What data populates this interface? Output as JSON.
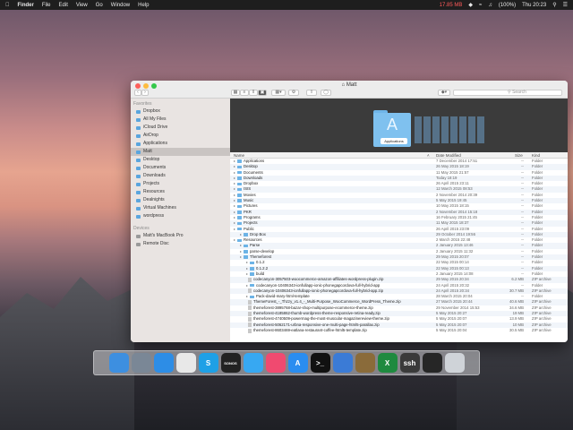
{
  "menubar": {
    "app": "Finder",
    "items": [
      "File",
      "Edit",
      "View",
      "Go",
      "Window",
      "Help"
    ],
    "memory": "17.85 MB",
    "battery": "(100%)",
    "clock": "Thu 20:23"
  },
  "window": {
    "title": "Matt",
    "search_placeholder": "Search"
  },
  "sidebar": {
    "favorites_header": "Favorites",
    "favorites": [
      "Dropbox",
      "All My Files",
      "iCloud Drive",
      "AirDrop",
      "Applications",
      "Matt",
      "Desktop",
      "Documents",
      "Downloads",
      "Projects",
      "Resources",
      "Dealnights",
      "Virtual Machines",
      "wordpress"
    ],
    "selected_index": 5,
    "devices_header": "Devices",
    "devices": [
      "Matt's MacBook Pro",
      "Remote Disc"
    ]
  },
  "coverflow": {
    "caption": "Applications"
  },
  "columns": {
    "name": "Name",
    "date": "Date Modified",
    "size": "Size",
    "kind": "Kind"
  },
  "rows": [
    {
      "name": "Applications",
      "date": "7 December 2014 17:51",
      "size": "--",
      "kind": "Folder",
      "indent": 0,
      "type": "folder"
    },
    {
      "name": "Desktop",
      "date": "26 May 2015 18:19",
      "size": "--",
      "kind": "Folder",
      "indent": 0,
      "type": "folder"
    },
    {
      "name": "Documents",
      "date": "11 May 2015 21:57",
      "size": "--",
      "kind": "Folder",
      "indent": 0,
      "type": "folder"
    },
    {
      "name": "Downloads",
      "date": "Today 18:19",
      "size": "--",
      "kind": "Folder",
      "indent": 0,
      "type": "folder"
    },
    {
      "name": "Dropbox",
      "date": "26 April 2015 23:11",
      "size": "--",
      "kind": "Folder",
      "indent": 0,
      "type": "folder"
    },
    {
      "name": "ISIS",
      "date": "12 March 2015 08:53",
      "size": "--",
      "kind": "Folder",
      "indent": 0,
      "type": "folder"
    },
    {
      "name": "Movies",
      "date": "2 November 2014 20:39",
      "size": "--",
      "kind": "Folder",
      "indent": 0,
      "type": "folder"
    },
    {
      "name": "Music",
      "date": "5 May 2015 19:45",
      "size": "--",
      "kind": "Folder",
      "indent": 0,
      "type": "folder"
    },
    {
      "name": "Pictures",
      "date": "10 May 2015 18:15",
      "size": "--",
      "kind": "Folder",
      "indent": 0,
      "type": "folder"
    },
    {
      "name": "PKR",
      "date": "2 November 2014 15:18",
      "size": "--",
      "kind": "Folder",
      "indent": 0,
      "type": "folder"
    },
    {
      "name": "Programs",
      "date": "16 February 2015 21:45",
      "size": "--",
      "kind": "Folder",
      "indent": 0,
      "type": "folder"
    },
    {
      "name": "Projects",
      "date": "11 May 2015 18:37",
      "size": "--",
      "kind": "Folder",
      "indent": 0,
      "type": "folder"
    },
    {
      "name": "Public",
      "date": "26 April 2015 23:09",
      "size": "--",
      "kind": "Folder",
      "indent": 0,
      "type": "folder"
    },
    {
      "name": "Drop Box",
      "date": "29 October 2014 19:56",
      "size": "--",
      "kind": "Folder",
      "indent": 1,
      "type": "folder"
    },
    {
      "name": "Resources",
      "date": "2 March 2015 22:48",
      "size": "--",
      "kind": "Folder",
      "indent": 0,
      "type": "folder"
    },
    {
      "name": "Parse",
      "date": "2 January 2015 13:46",
      "size": "--",
      "kind": "Folder",
      "indent": 1,
      "type": "folder"
    },
    {
      "name": "parse-develop",
      "date": "2 January 2015 11:32",
      "size": "--",
      "kind": "Folder",
      "indent": 1,
      "type": "folder"
    },
    {
      "name": "Themeforest",
      "date": "29 May 2015 20:07",
      "size": "--",
      "kind": "Folder",
      "indent": 1,
      "type": "folder"
    },
    {
      "name": "0.1.2",
      "date": "22 May 2015 00:14",
      "size": "--",
      "kind": "Folder",
      "indent": 2,
      "type": "folder"
    },
    {
      "name": "0.1.2.2",
      "date": "22 May 2015 00:13",
      "size": "--",
      "kind": "Folder",
      "indent": 2,
      "type": "folder"
    },
    {
      "name": "build",
      "date": "2 January 2015 14:08",
      "size": "--",
      "kind": "Folder",
      "indent": 2,
      "type": "folder"
    },
    {
      "name": "codecanyon-3057503-woocommerce-amazon-affiliates-wordpress-plugin.zip",
      "date": "29 May 2015 20:34",
      "size": "6.2 MB",
      "kind": "ZIP archive",
      "indent": 2,
      "type": "zip"
    },
    {
      "name": "codecanyon-10406343-ionfullapp-ionic-phonegapcordova-full-hybrid-app",
      "date": "24 April 2015 20:32",
      "size": "--",
      "kind": "Folder",
      "indent": 2,
      "type": "folder"
    },
    {
      "name": "codecanyon-10406343-ionfullapp-ionic-phonegapcordova-full-hybrid-app.zip",
      "date": "24 April 2015 20:34",
      "size": "30.7 MB",
      "kind": "ZIP archive",
      "indent": 2,
      "type": "zip"
    },
    {
      "name": "Pack-david-mary-html-template",
      "date": "28 March 2015 20:04",
      "size": "--",
      "kind": "Folder",
      "indent": 2,
      "type": "folder"
    },
    {
      "name": "ThemeForest_-_Thzzy_v1.4_-_Multi-Purpose_WooCommerce_WordPress_Theme.zip",
      "date": "27 March 2015 20:44",
      "size": "40.6 MB",
      "kind": "ZIP archive",
      "indent": 2,
      "type": "zip"
    },
    {
      "name": "themeforest-3895768-bazar-shop-multipurpose-ecommerce-theme.zip",
      "date": "29 November 2014 15:53",
      "size": "34.6 MB",
      "kind": "ZIP archive",
      "indent": 2,
      "type": "zip"
    },
    {
      "name": "themeforest-4185862-thumb-wordpress-theme-responsive-retina-ready.zip",
      "date": "5 May 2015 20:27",
      "size": "19 MB",
      "kind": "ZIP archive",
      "indent": 2,
      "type": "zip"
    },
    {
      "name": "themeforest-4740509-powermag-the-most-muscular-magazinereview-theme.zip",
      "date": "5 May 2015 20:07",
      "size": "13.9 MB",
      "kind": "ZIP archive",
      "indent": 2,
      "type": "zip"
    },
    {
      "name": "themeforest-5062171-urbna-responsive-one-multi-page-html5-parallax.zip",
      "date": "5 May 2015 20:07",
      "size": "10 MB",
      "kind": "ZIP archive",
      "indent": 2,
      "type": "zip"
    },
    {
      "name": "themeforest-8603469-eatlana-restaurant-coffee-html5-template.zip",
      "date": "5 May 2015 20:04",
      "size": "30.5 MB",
      "kind": "ZIP archive",
      "indent": 2,
      "type": "zip"
    }
  ],
  "dock": [
    {
      "name": "finder",
      "label": "",
      "color": "#3d8fe0"
    },
    {
      "name": "launchpad",
      "label": "",
      "color": "#7a8796"
    },
    {
      "name": "safari",
      "label": "",
      "color": "#2d8de6"
    },
    {
      "name": "chrome",
      "label": "",
      "color": "#e8e8e8"
    },
    {
      "name": "skype",
      "label": "S",
      "color": "#1ea0e6"
    },
    {
      "name": "sonos",
      "label": "SONOS",
      "color": "#222222"
    },
    {
      "name": "messages",
      "label": "",
      "color": "#37a8f2"
    },
    {
      "name": "itunes",
      "label": "",
      "color": "#f04a70"
    },
    {
      "name": "app-store",
      "label": "A",
      "color": "#2a8df0"
    },
    {
      "name": "terminal",
      "label": ">_",
      "color": "#111111"
    },
    {
      "name": "xcode",
      "label": "",
      "color": "#3b7bd6"
    },
    {
      "name": "disk-utility",
      "label": "",
      "color": "#8a6b3a"
    },
    {
      "name": "excel",
      "label": "X",
      "color": "#1e8a3f"
    },
    {
      "name": "ssh",
      "label": "ssh",
      "color": "#3a3a3a"
    },
    {
      "name": "console",
      "label": "",
      "color": "#262626"
    },
    {
      "name": "trash",
      "label": "",
      "color": "#cfd3d8"
    }
  ]
}
